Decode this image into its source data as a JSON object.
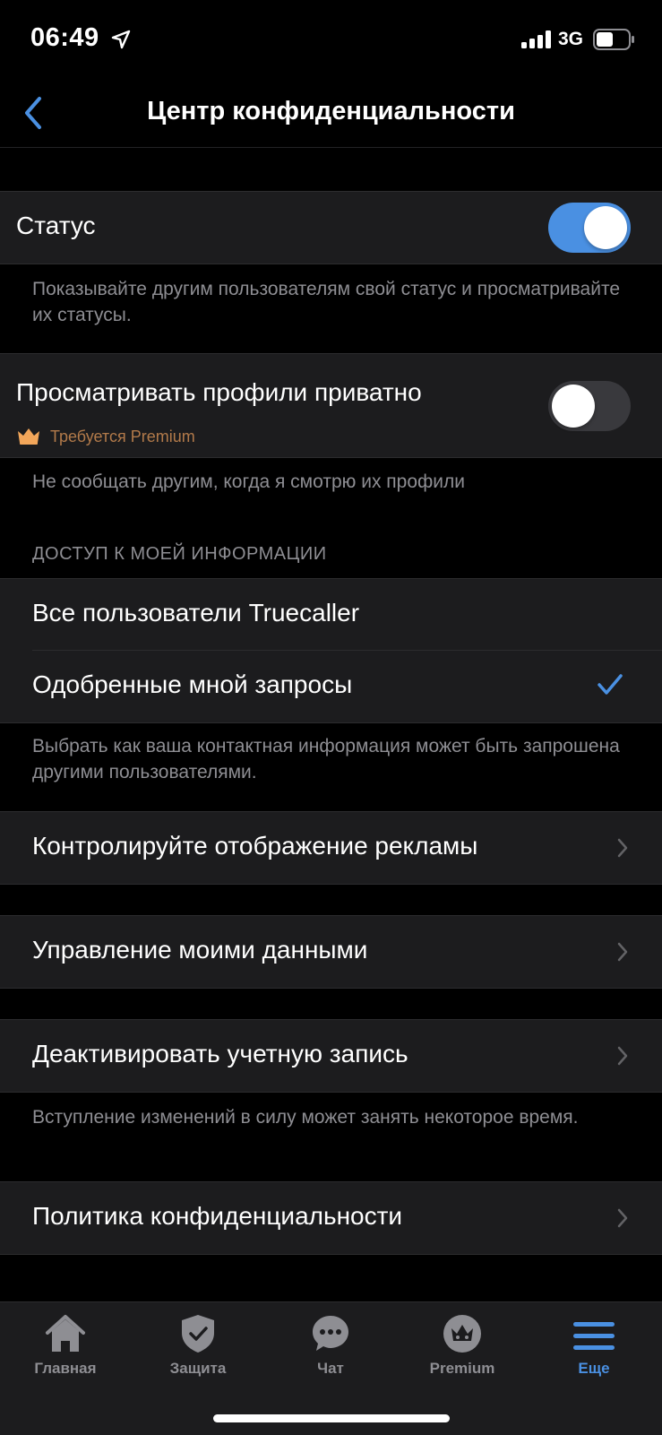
{
  "status_bar": {
    "time": "06:49",
    "network": "3G"
  },
  "nav": {
    "title": "Центр конфиденциальности"
  },
  "status_setting": {
    "label": "Статус",
    "enabled": true,
    "footnote": "Показывайте другим пользователям свой статус и просматривайте их статусы."
  },
  "private_view": {
    "label": "Просматривать профили приватно",
    "enabled": false,
    "premium_label": "Требуется Premium",
    "footnote": "Не сообщать другим, когда я смотрю их профили"
  },
  "access": {
    "header": "ДОСТУП К МОЕЙ ИНФОРМАЦИИ",
    "options": [
      {
        "label": "Все пользователи Truecaller",
        "selected": false
      },
      {
        "label": "Одобренные мной запросы",
        "selected": true
      }
    ],
    "footnote": "Выбрать как ваша контактная информация может быть запрошена другими пользователями."
  },
  "ads": {
    "label": "Контролируйте отображение рекламы"
  },
  "data": {
    "label": "Управление моими данными"
  },
  "deactivate": {
    "label": "Деактивировать учетную запись",
    "footnote": "Вступление изменений в силу может занять некоторое время."
  },
  "policy": {
    "label": "Политика конфиденциальности"
  },
  "tabs": [
    {
      "label": "Главная",
      "icon": "home-icon",
      "active": false
    },
    {
      "label": "Защита",
      "icon": "shield-icon",
      "active": false
    },
    {
      "label": "Чат",
      "icon": "chat-icon",
      "active": false
    },
    {
      "label": "Premium",
      "icon": "crown-icon",
      "active": false
    },
    {
      "label": "Еще",
      "icon": "menu-icon",
      "active": true
    }
  ],
  "colors": {
    "accent": "#4a90e2",
    "background": "#000000",
    "cell": "#1c1c1e",
    "premium": "#b27a4a"
  }
}
